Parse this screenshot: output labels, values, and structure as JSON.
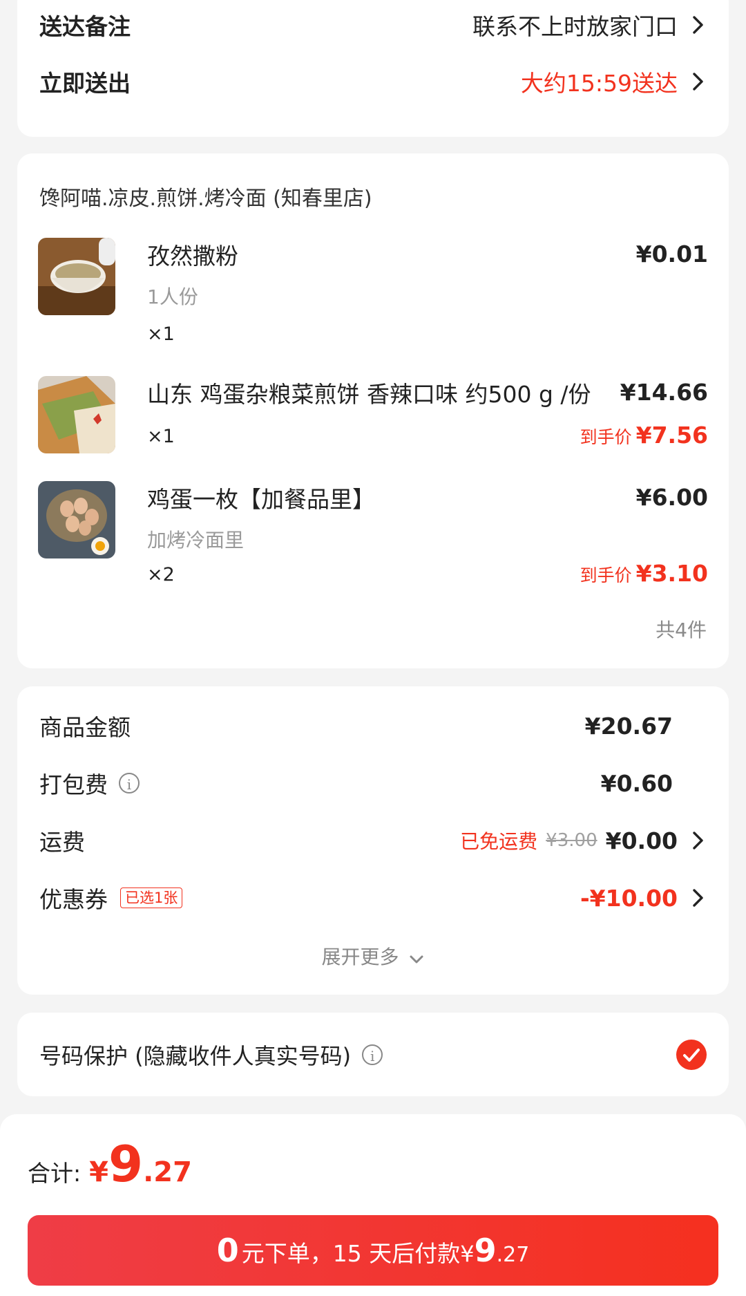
{
  "delivery": {
    "note_label": "送达备注",
    "note_value": "联系不上时放家门口",
    "send_label": "立即送出",
    "send_value": "大约15:59送达"
  },
  "store": {
    "name": "馋阿喵.凉皮.煎饼.烤冷面 (知春里店)",
    "items": [
      {
        "name": "孜然撒粉",
        "spec": "1人份",
        "qty": "×1",
        "price": "¥0.01",
        "thumb_icon": "seasoning-powder-icon"
      },
      {
        "name": "山东 鸡蛋杂粮菜煎饼 香辣口味 约500 g /份",
        "qty": "×1",
        "price": "¥14.66",
        "deal_label": "到手价",
        "deal_price": "¥7.56",
        "thumb_icon": "jianbing-pancake-icon"
      },
      {
        "name": "鸡蛋一枚【加餐品里】",
        "spec": "加烤冷面里",
        "qty": "×2",
        "price": "¥6.00",
        "deal_label": "到手价",
        "deal_price": "¥3.10",
        "thumb_icon": "eggs-basket-icon"
      }
    ],
    "total_count": "共4件"
  },
  "fees": {
    "goods_label": "商品金额",
    "goods_value": "¥20.67",
    "pack_label": "打包费",
    "pack_value": "¥0.60",
    "ship_label": "运费",
    "ship_free": "已免运费",
    "ship_original": "¥3.00",
    "ship_value": "¥0.00",
    "coupon_label": "优惠券",
    "coupon_badge": "已选1张",
    "coupon_value": "-¥10.00",
    "expand": "展开更多"
  },
  "privacy": {
    "label": "号码保护 (隐藏收件人真实号码)",
    "checked": true
  },
  "footer": {
    "total_label": "合计:",
    "total_currency": "¥",
    "total_int": "9",
    "total_dec": ".27",
    "btn_zero": "0",
    "btn_text": "元下单，15 天后付款",
    "btn_currency": "¥",
    "btn_int": "9",
    "btn_dec": ".27"
  },
  "colors": {
    "accent": "#f2321e",
    "button": "#f5301f"
  }
}
